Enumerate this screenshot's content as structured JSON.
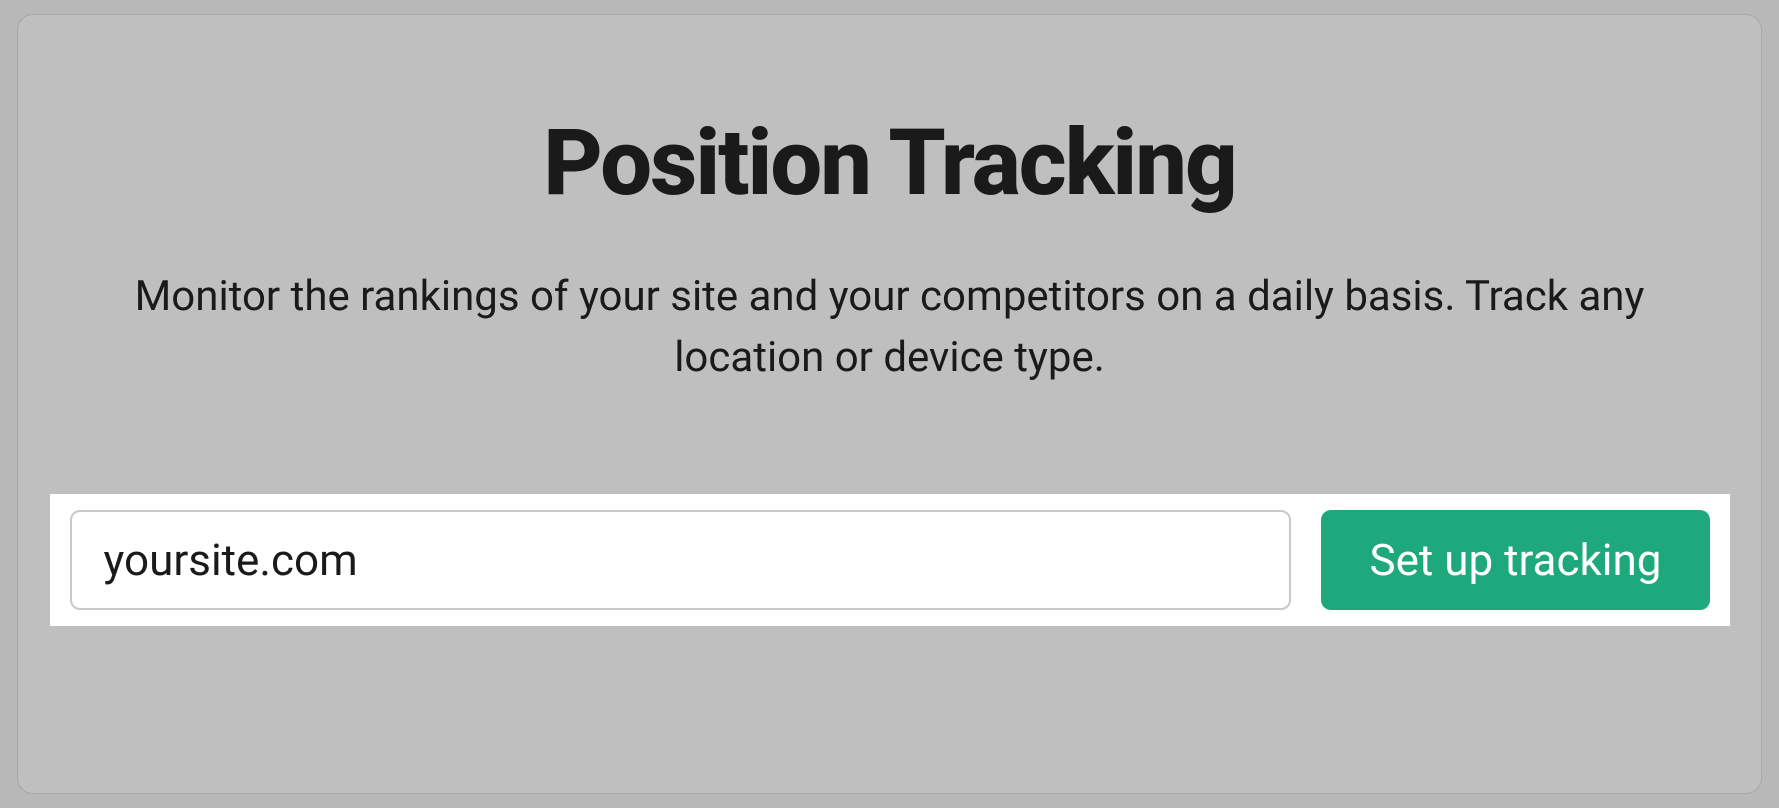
{
  "header": {
    "title": "Position Tracking",
    "subtitle": "Monitor the rankings of your site and your competitors on a daily basis. Track any location or device type."
  },
  "form": {
    "domain_placeholder": "yoursite.com",
    "domain_value": "",
    "submit_label": "Set up tracking"
  },
  "colors": {
    "accent": "#1ea97c"
  }
}
